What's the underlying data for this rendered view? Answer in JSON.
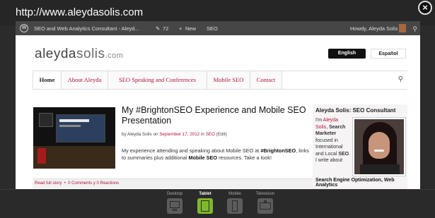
{
  "preview": {
    "url": "http://www.aleydasolis.com",
    "close_glyph": "×"
  },
  "admin_bar": {
    "site_name": "SEO and Web Analytics Consultant - Aleyd...",
    "comments_count": "72",
    "new_label": "New",
    "seo_label": "SEO",
    "greeting": "Howdy, Aleyda Solis"
  },
  "site": {
    "logo_main": "aleyda",
    "logo_bold": "solis",
    "logo_tld": ".com",
    "lang_en": "English",
    "lang_es": "Español"
  },
  "nav": {
    "items": [
      "Home",
      "About Aleyda",
      "SEO Speaking and Conferences",
      "Mobile SEO",
      "Contact"
    ],
    "active": "Home"
  },
  "post": {
    "title": "My #BrightonSEO Experience and Mobile SEO Presentation",
    "meta_prefix": "by Aleyda Solis on ",
    "meta_date": "September 17, 2012",
    "meta_in": " in ",
    "meta_cat": "SEO",
    "meta_edit": " (Edit)",
    "excerpt_1": "My experience attending and speaking about Mobile SEO at ",
    "excerpt_bold_1": "#BrightonSEO",
    "excerpt_2": ", links to summaries plus additional ",
    "excerpt_bold_2": "Mobile SEO",
    "excerpt_3": " resources. Take a look!",
    "read_more": "Read full story",
    "comments": "0 Comments y 0 Reactions"
  },
  "sidebar": {
    "title": "Aleyda Solis: SEO Consultant",
    "intro": "I'm ",
    "name_link": "Aleyda Solis",
    "text_1": ", ",
    "bold_1": "Search Marketer",
    "text_2": " focused in International and Local ",
    "bold_2": "SEO",
    "text_3": ". I write about ",
    "bold_3": "Search Engine Optimization, Web Analytics"
  },
  "devices": {
    "desktop": "Desktop",
    "tablet": "Tablet",
    "mobile": "Mobile",
    "television": "Television",
    "active": "Tablet"
  }
}
